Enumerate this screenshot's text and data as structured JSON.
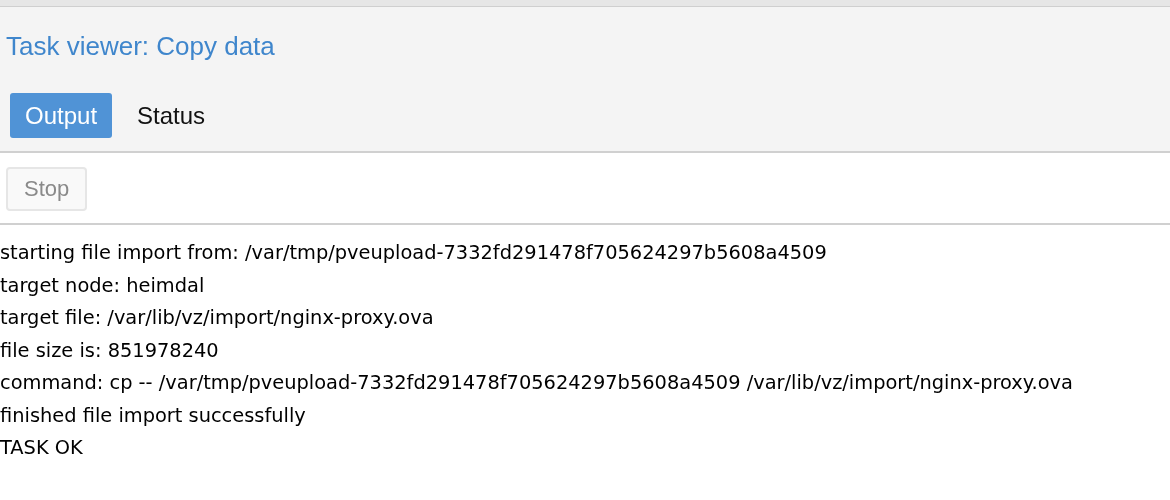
{
  "window": {
    "title": "Task viewer: Copy data"
  },
  "tabs": [
    {
      "label": "Output",
      "selected": true
    },
    {
      "label": "Status",
      "selected": false
    }
  ],
  "toolbar": {
    "stop_button": {
      "label": "Stop",
      "disabled": true
    }
  },
  "log_lines": [
    "starting file import from: /var/tmp/pveupload-7332fd291478f705624297b5608a4509",
    "target node: heimdal",
    "target file: /var/lib/vz/import/nginx-proxy.ova",
    "file size is: 851978240",
    "command: cp -- /var/tmp/pveupload-7332fd291478f705624297b5608a4509 /var/lib/vz/import/nginx-proxy.ova",
    "finished file import successfully",
    "TASK OK"
  ]
}
